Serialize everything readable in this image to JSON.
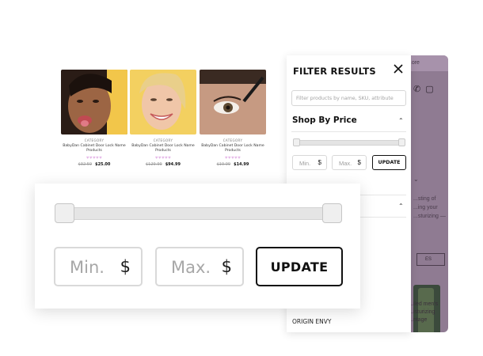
{
  "products": [
    {
      "category": "CATEGORY",
      "name": "BabyDan Cabinet Door Lock Name Products",
      "hearts": "♥♥♥♥♥",
      "old_price": "$32.59",
      "price": "$25.00"
    },
    {
      "category": "CATEGORY",
      "name": "BabyDan Cabinet Door Lock Name Products",
      "hearts": "♥♥♥♥♥",
      "old_price": "$129.99",
      "price": "$94.99"
    },
    {
      "category": "CATEGORY",
      "name": "BabyDan Cabinet Door Lock Name Products",
      "hearts": "♥♥♥♥♥",
      "old_price": "$19.99",
      "price": "$14.99"
    }
  ],
  "drawer": {
    "title": "FILTER RESULTS",
    "search_placeholder": "Filter products by name, SKU, attribute",
    "price_section_title": "Shop By Price",
    "min_placeholder": "Min.",
    "max_placeholder": "Max.",
    "currency": "$",
    "update_label": "UPDATE",
    "brand_item": "ORIGIN ENVY"
  },
  "background_page": {
    "top_text": "...ore",
    "desc_text": "...sting of ...ing your ...sturizing —",
    "outline_label": "ES",
    "product_caption": "...iled men's ...isturizing ...ntage"
  },
  "zoom": {
    "min_placeholder": "Min.",
    "max_placeholder": "Max.",
    "currency": "$",
    "update_label": "UPDATE"
  },
  "colors": {
    "accent_hearts": "#e5b8e8",
    "overlay": "#8f7b92",
    "border_dark": "#111111"
  },
  "icons": [
    "close-icon",
    "chevron-up-icon",
    "phone-icon",
    "bag-icon"
  ]
}
